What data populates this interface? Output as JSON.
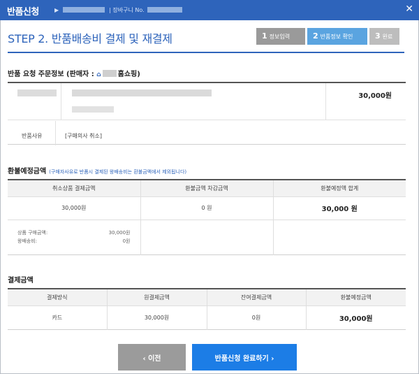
{
  "header": {
    "title": "반품신청",
    "crumb_prefix": "▶",
    "crumb_sep": "|",
    "crumb_label": "장바구니 No.",
    "close": "✕"
  },
  "step_title": "STEP 2. 반품배송비 결제 및 재결제",
  "steps": [
    {
      "num": "1",
      "label": "정보입력"
    },
    {
      "num": "2",
      "label": "반품정보 확인"
    },
    {
      "num": "3",
      "label": "완료"
    }
  ],
  "order": {
    "section_title_prefix": "반품 요청 주문정보 (판매자 : ",
    "section_title_suffix": "홈쇼핑)",
    "price": "30,000원",
    "reason_label": "반품사유",
    "reason_text": "[구매의사 취소]"
  },
  "refund": {
    "section_title": "환불예정금액",
    "note": "(구매자사유로 반품시 결제된 왕배송비는 환불금액에서 제외됩니다)",
    "headers": [
      "취소상품 결제금액",
      "환불금액 차감금액",
      "환불예정액 합계"
    ],
    "values": [
      "30,000원",
      "0 원",
      "30,000 원"
    ],
    "details": [
      {
        "label": "상품 구매금액:",
        "value": "30,000원"
      },
      {
        "label": "왕배송비:",
        "value": "0원"
      }
    ]
  },
  "payment": {
    "section_title": "결제금액",
    "headers": [
      "결제방식",
      "원결제금액",
      "잔여결제금액",
      "환불예정금액"
    ],
    "values": [
      "카드",
      "30,000원",
      "0원",
      "30,000원"
    ]
  },
  "buttons": {
    "prev": "‹ 이전",
    "done": "반품신청 완료하기 ›"
  }
}
